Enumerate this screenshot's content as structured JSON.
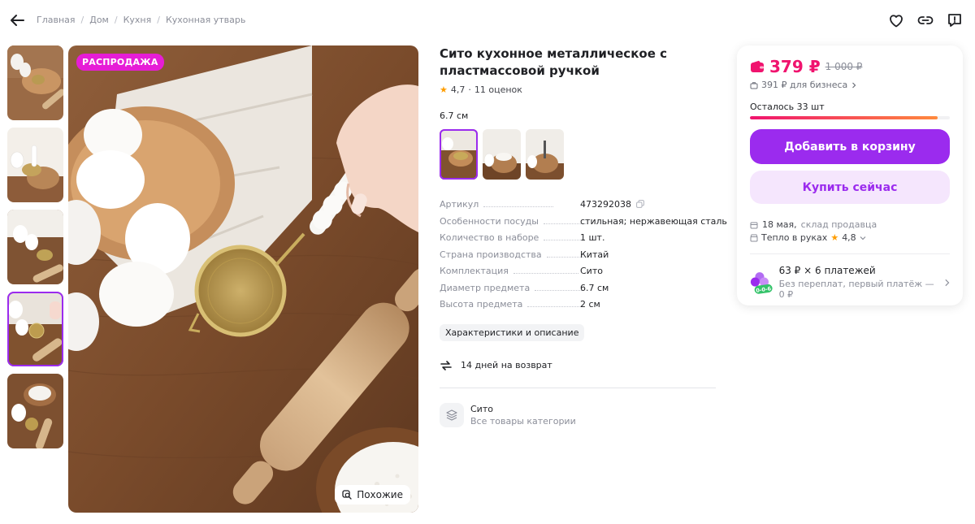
{
  "breadcrumbs": [
    "Главная",
    "Дом",
    "Кухня",
    "Кухонная утварь"
  ],
  "gallery": {
    "sale_badge": "РАСПРОДАЖА",
    "similar_label": "Похожие",
    "thumbnail_count": 5,
    "active_thumbnail": 4
  },
  "product": {
    "title": "Сито кухонное металлическое с пластмассовой ручкой",
    "rating": "4,7",
    "reviews": "11 оценок",
    "variant_label": "6.7 см",
    "specs": [
      {
        "name": "Артикул",
        "value": "473292038"
      },
      {
        "name": "Особенности посуды",
        "value": "стильная; нержавеющая сталь"
      },
      {
        "name": "Количество в наборе",
        "value": "1 шт."
      },
      {
        "name": "Страна производства",
        "value": "Китай"
      },
      {
        "name": "Комплектация",
        "value": "Сито"
      },
      {
        "name": "Диаметр предмета",
        "value": "6.7 см"
      },
      {
        "name": "Высота предмета",
        "value": "2 см"
      }
    ],
    "details_chip": "Характеристики и описание",
    "return_text": "14 дней на возврат",
    "category": {
      "name": "Сито",
      "subtitle": "Все товары категории"
    }
  },
  "buybox": {
    "price": "379 ₽",
    "old_price": "1 000 ₽",
    "business_price": "391 ₽ для бизнеса",
    "stock_text": "Осталось 33 шт",
    "stock_fill": 0.94,
    "add_to_cart": "Добавить в корзину",
    "buy_now": "Купить сейчас",
    "delivery_date": "18 мая,",
    "delivery_source": "склад продавца",
    "warm_label": "Тепло в руках",
    "warm_rating": "4,8",
    "installment_title": "63 ₽ × 6 платежей",
    "installment_sub": "Без переплат, первый платёж — 0 ₽",
    "installment_badge": "0-0-6"
  },
  "colors": {
    "accent": "#9b2bee",
    "price": "#f0136e",
    "sale_badge": "#e61dd6"
  }
}
